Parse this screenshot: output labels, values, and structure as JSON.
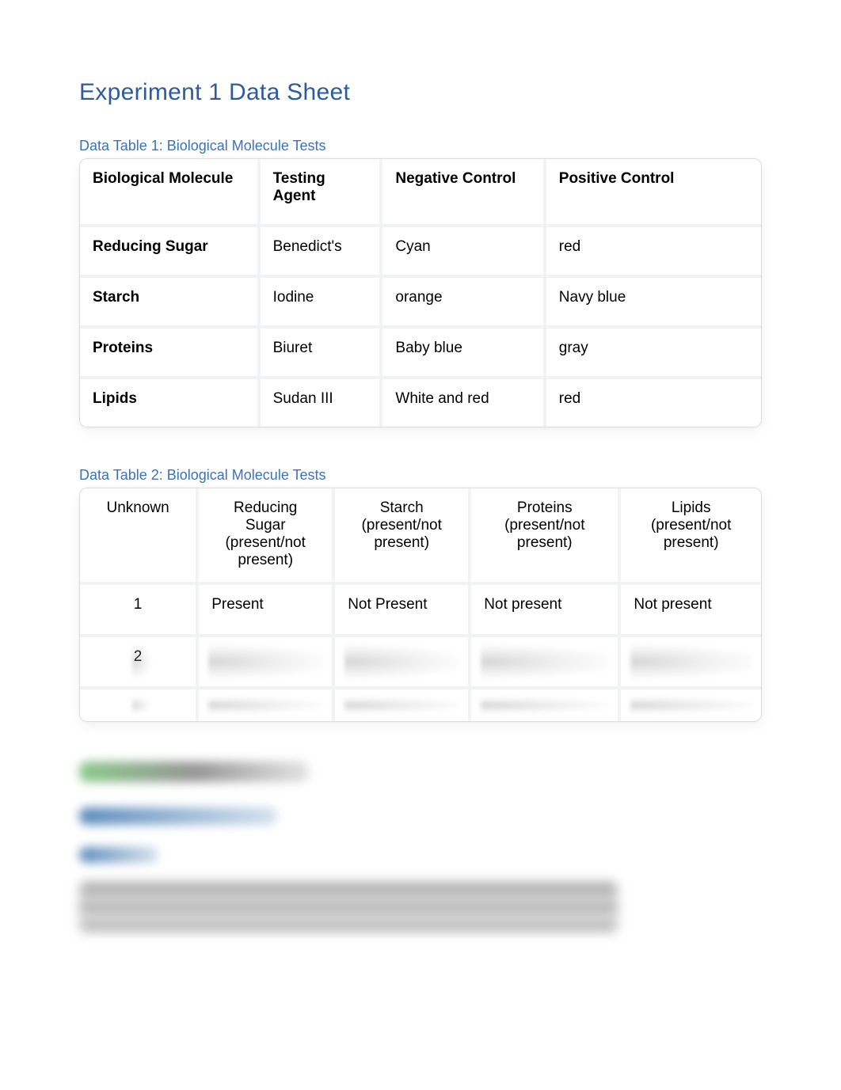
{
  "title": "Experiment 1 Data Sheet",
  "table1": {
    "heading": "Data Table 1: Biological Molecule Tests",
    "headers": {
      "molecule": "Biological Molecule",
      "agent": "Testing Agent",
      "negative": "Negative Control",
      "positive": "Positive Control"
    },
    "rows": [
      {
        "molecule": "Reducing Sugar",
        "agent": "Benedict's",
        "negative": "Cyan",
        "positive": "red"
      },
      {
        "molecule": "Starch",
        "agent": "Iodine",
        "negative": "orange",
        "positive": "Navy blue"
      },
      {
        "molecule": "Proteins",
        "agent": "Biuret",
        "negative": "Baby blue",
        "positive": "gray"
      },
      {
        "molecule": "Lipids",
        "agent": "Sudan III",
        "negative": "White and red",
        "positive": "red"
      }
    ]
  },
  "table2": {
    "heading": "Data Table 2: Biological Molecule Tests",
    "headers": {
      "unknown": "Unknown",
      "reducing": "Reducing Sugar (present/not present)",
      "starch": "Starch (present/not present)",
      "proteins": "Proteins (present/not present)",
      "lipids": "Lipids (present/not present)"
    },
    "rows": [
      {
        "unknown": "1",
        "reducing": "Present",
        "starch": "Not Present",
        "proteins": "Not present",
        "lipids": "Not present"
      },
      {
        "unknown": "2",
        "reducing": "",
        "starch": "",
        "proteins": "",
        "lipids": ""
      },
      {
        "unknown": "",
        "reducing": "",
        "starch": "",
        "proteins": "",
        "lipids": ""
      }
    ]
  }
}
